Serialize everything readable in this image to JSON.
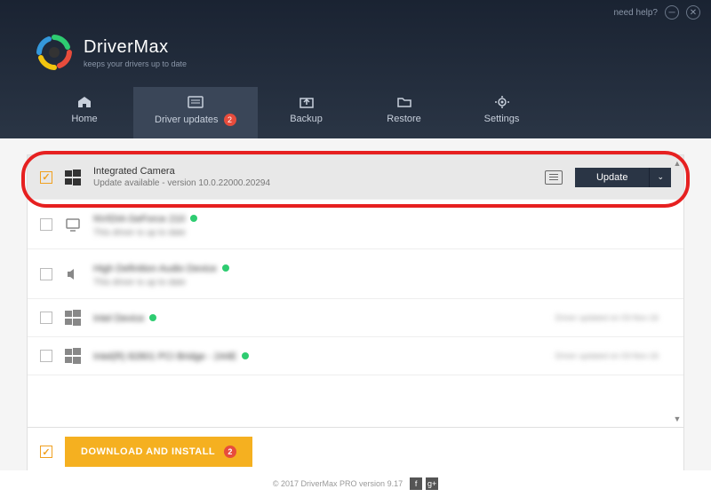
{
  "titlebar": {
    "help": "need help?"
  },
  "brand": {
    "name": "DriverMax",
    "tagline": "keeps your drivers up to date"
  },
  "tabs": {
    "home": "Home",
    "updates": "Driver updates",
    "updates_badge": "2",
    "backup": "Backup",
    "restore": "Restore",
    "settings": "Settings"
  },
  "rows": {
    "r0": {
      "title": "Integrated Camera",
      "sub": "Update available - version 10.0.22000.20294",
      "update_btn": "Update"
    },
    "r1": {
      "title": "NVIDIA GeForce 210",
      "sub": "This driver is up to date"
    },
    "r2": {
      "title": "High Definition Audio Device",
      "sub": "This driver is up to date"
    },
    "r3": {
      "title": "Intel Device",
      "sub": "",
      "right": "Driver updated on 03-Nov-16"
    },
    "r4": {
      "title": "Intel(R) 82801 PCI Bridge - 244E",
      "sub": "",
      "right": "Driver updated on 03-Nov-16"
    }
  },
  "bottom": {
    "download": "DOWNLOAD AND INSTALL",
    "badge": "2"
  },
  "footer": {
    "copyright": "© 2017 DriverMax PRO version 9.17"
  }
}
